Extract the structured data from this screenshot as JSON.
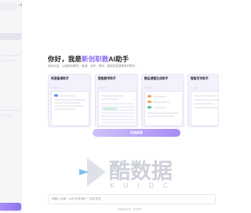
{
  "greeting": {
    "prefix": "你好，我是",
    "brand": "新创职教",
    "suffix": "AI助手"
  },
  "subtitle": "轻松对话，让我助你教学、备课、创作、教研，做您的智慧教育好帮手~",
  "cards": [
    {
      "title": "资源备课助手",
      "desc": "",
      "chips": [
        "",
        "",
        "",
        ""
      ]
    },
    {
      "title": "智能教学助手",
      "desc": "",
      "chips": [
        "",
        "",
        ""
      ]
    },
    {
      "title": "精品课程生成助手",
      "desc": "",
      "chips": [
        "",
        "",
        ""
      ]
    },
    {
      "title": "智能写作助手",
      "desc": "",
      "chips": [
        "",
        "",
        ""
      ]
    }
  ],
  "try_button": "开始体验",
  "watermark": {
    "main": "酷数据",
    "sub": "KUIDC"
  },
  "input": {
    "placeholder": "请输入问题，shift+回车换行，回车发送"
  },
  "disclaimer": "内容由AI生成，仅供参考",
  "colors": {
    "accent": "#8b6ff0",
    "button_from": "#cfc2fa",
    "button_to": "#a78df6",
    "card_bg": "#f3f1fb"
  }
}
